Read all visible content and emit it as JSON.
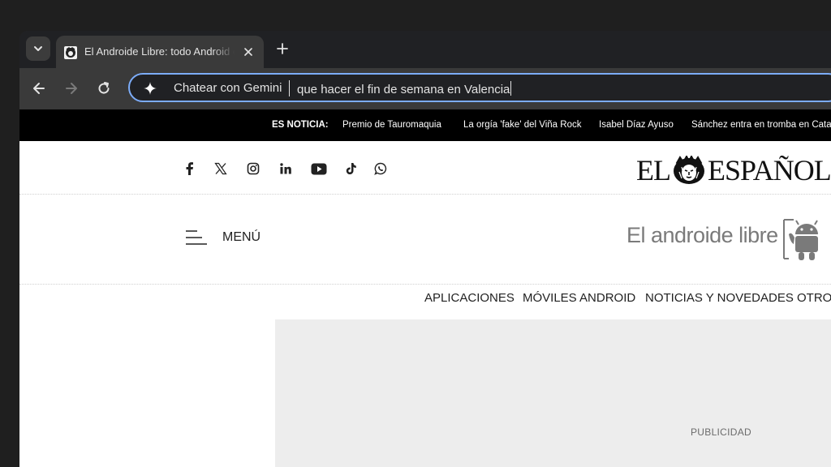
{
  "browser": {
    "tab": {
      "title": "El Androide Libre: todo Android en español",
      "favicon": "lion-favicon-icon"
    },
    "omnibox": {
      "chip": "Chatear con Gemini",
      "query": "que hacer el fin de semana en Valencia",
      "border_color": "#7cacf8"
    }
  },
  "newsbar": {
    "label": "ES NOTICIA:",
    "items": [
      "Premio de Tauromaquia",
      "La orgía 'fake' del Viña Rock",
      "Isabel Díaz Ayuso",
      "Sánchez entra en tromba en Cataluña"
    ]
  },
  "social_icons": [
    "facebook-icon",
    "x-icon",
    "instagram-icon",
    "linkedin-icon",
    "youtube-icon",
    "tiktok-icon",
    "whatsapp-icon"
  ],
  "brand": {
    "parent": "EL ESPAÑOL",
    "parent_left": "EL",
    "parent_right": "ESPAÑOL",
    "site": "El androide libre"
  },
  "menu": {
    "label": "MENÚ"
  },
  "sections": [
    "APLICACIONES",
    "MÓVILES ANDROID",
    "NOTICIAS Y NOVEDADES",
    "OTROS"
  ],
  "ad": {
    "label": "PUBLICIDAD"
  }
}
